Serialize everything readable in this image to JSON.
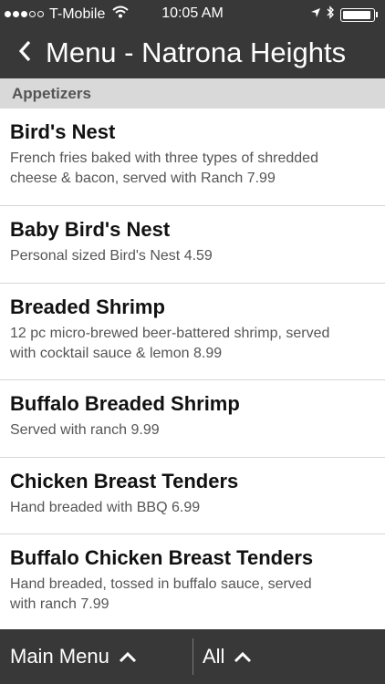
{
  "status_bar": {
    "carrier": "T-Mobile",
    "time": "10:05 AM",
    "signal_bars_filled": 3,
    "signal_bars_total": 5,
    "battery_level": 0.95
  },
  "nav": {
    "title": "Menu - Natrona Heights",
    "back_icon": "chevron-left-icon"
  },
  "section": {
    "title": "Appetizers"
  },
  "items": [
    {
      "name": "Bird's Nest",
      "desc_lines": [
        "French fries baked with three types of shredded",
        "cheese & bacon, served with Ranch 7.99"
      ]
    },
    {
      "name": "Baby Bird's Nest",
      "desc_lines": [
        "Personal sized Bird's Nest 4.59"
      ]
    },
    {
      "name": "Breaded Shrimp",
      "desc_lines": [
        "12 pc micro-brewed beer-battered shrimp, served",
        "with cocktail sauce & lemon 8.99"
      ]
    },
    {
      "name": "Buffalo Breaded Shrimp",
      "desc_lines": [
        "Served with ranch 9.99"
      ]
    },
    {
      "name": "Chicken Breast Tenders",
      "desc_lines": [
        "Hand breaded with BBQ 6.99"
      ]
    },
    {
      "name": "Buffalo Chicken Breast Tenders",
      "desc_lines": [
        "Hand breaded, tossed in buffalo sauce, served",
        "with ranch 7.99"
      ]
    }
  ],
  "tab_bar": {
    "main_menu_label": "Main Menu",
    "all_label": "All",
    "chevron_icon": "chevron-up-icon"
  },
  "colors": {
    "bar_background": "#383838",
    "section_background": "#d9d9d9",
    "item_title": "#111111",
    "item_description": "#555555"
  }
}
